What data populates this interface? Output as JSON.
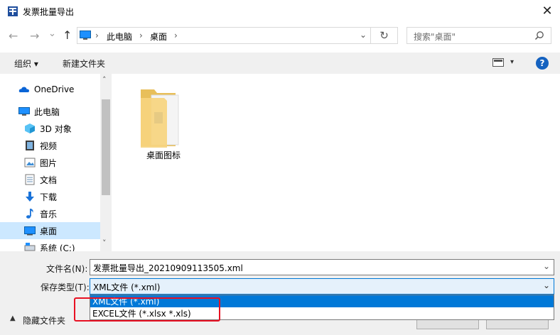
{
  "window": {
    "title": "发票批量导出",
    "close_glyph": "✕"
  },
  "nav": {
    "back_glyph": "←",
    "forward_glyph": "→",
    "dropdown_glyph": "⌄",
    "up_glyph": "↑",
    "breadcrumb": [
      "此电脑",
      "桌面"
    ],
    "breadcrumb_sep": "›",
    "refresh_glyph": "↻",
    "search_placeholder": "搜索\"桌面\""
  },
  "toolbar": {
    "organize": "组织 ▾",
    "new_folder": "新建文件夹",
    "help_glyph": "?"
  },
  "sidebar": {
    "items": [
      {
        "label": "OneDrive",
        "icon": "cloud-icon"
      },
      {
        "label": "此电脑",
        "icon": "computer-icon"
      },
      {
        "label": "3D 对象",
        "icon": "cube-icon"
      },
      {
        "label": "视频",
        "icon": "video-icon"
      },
      {
        "label": "图片",
        "icon": "picture-icon"
      },
      {
        "label": "文档",
        "icon": "document-icon"
      },
      {
        "label": "下载",
        "icon": "download-icon"
      },
      {
        "label": "音乐",
        "icon": "music-icon"
      },
      {
        "label": "桌面",
        "icon": "desktop-icon"
      },
      {
        "label": "系统 (C:)",
        "icon": "drive-icon"
      }
    ],
    "scroll_up": "˄",
    "scroll_down": "˅"
  },
  "content": {
    "items": [
      {
        "label": "桌面图标",
        "icon": "folder-icon"
      }
    ]
  },
  "bottom": {
    "filename_label": "文件名(N):",
    "filename_value": "发票批量导出_20210909113505.xml",
    "filetype_label": "保存类型(T):",
    "filetype_value": "XML文件 (*.xml)",
    "filetype_options": [
      "XML文件 (*.xml)",
      "EXCEL文件 (*.xlsx *.xls)"
    ],
    "hide_folders": "隐藏文件夹",
    "chevron": "⌄"
  },
  "colors": {
    "accent": "#0078d7",
    "highlight": "#e81123",
    "selected_nav": "#cce8ff"
  }
}
